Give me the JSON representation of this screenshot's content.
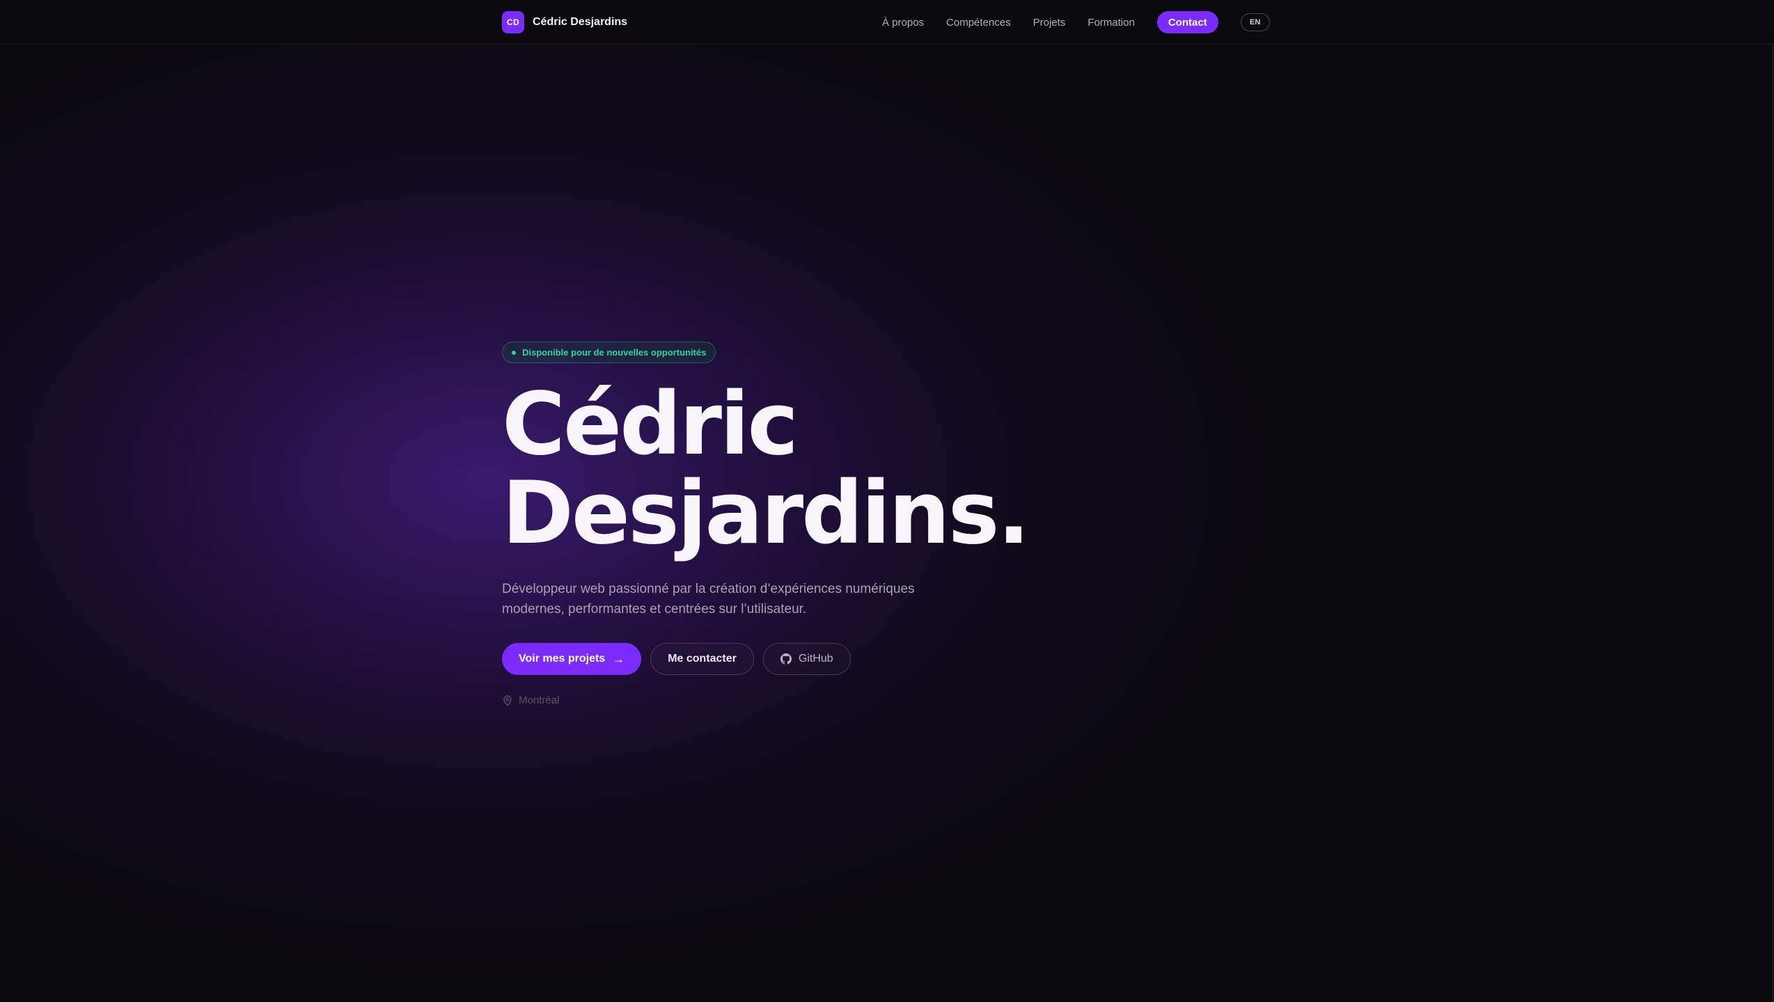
{
  "brand": {
    "logo_text": "CD",
    "name": "Cédric Desjardins"
  },
  "nav": {
    "links": [
      "À propos",
      "Compétences",
      "Projets",
      "Formation"
    ],
    "contact_label": "Contact",
    "lang_label": "EN"
  },
  "hero": {
    "badge": "Disponible pour de nouvelles opportunités",
    "title_line1": "Cédric",
    "title_line2": "Desjardins.",
    "subtitle": "Développeur web passionné par la création d’expériences numériques modernes, performantes et centrées sur l’utilisateur.",
    "cta_primary": "Voir mes projets",
    "cta_secondary": "Me contacter",
    "cta_github": "GitHub",
    "location": "Montréal"
  },
  "colors": {
    "accent": "#7c2bff",
    "available": "#34d399",
    "background": "#0b0a0e"
  },
  "icons": {
    "arrow": "arrow-right-icon",
    "github": "github-icon",
    "location": "map-pin-icon"
  }
}
